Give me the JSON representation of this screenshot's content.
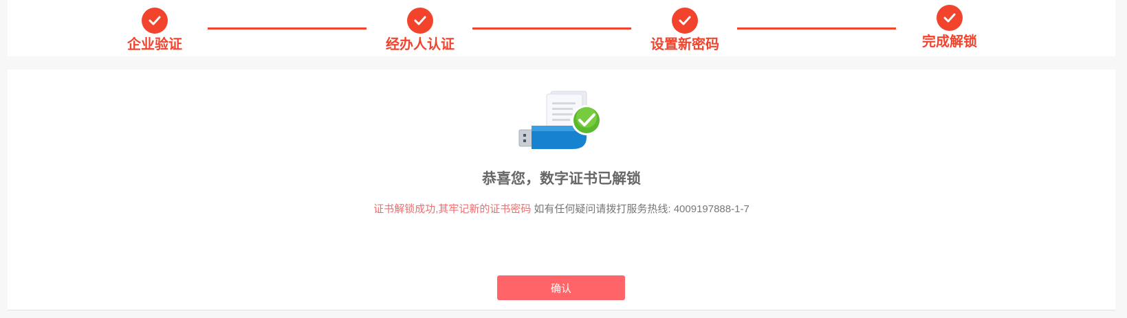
{
  "steps": [
    {
      "label": "企业验证",
      "state": "done",
      "icon": "check-icon"
    },
    {
      "label": "经办人认证",
      "state": "done",
      "icon": "check-icon"
    },
    {
      "label": "设置新密码",
      "state": "done",
      "icon": "check-icon"
    },
    {
      "label": "完成解锁",
      "state": "done",
      "icon": "check-icon"
    }
  ],
  "result": {
    "illustration_icon": "usb-key-certificate-success-icon",
    "title": "恭喜您，数字证书已解锁",
    "message_highlight": "证书解锁成功,其牢记新的证书密码",
    "message_normal": "如有任何疑问请拨打服务热线: 4009197888-1-7"
  },
  "actions": {
    "confirm_label": "确认"
  },
  "colors": {
    "accent": "#f2432d",
    "button": "#ff6468",
    "highlight_text": "#f26d6d",
    "muted_text": "#777777",
    "page_background": "#f7f7f7"
  }
}
